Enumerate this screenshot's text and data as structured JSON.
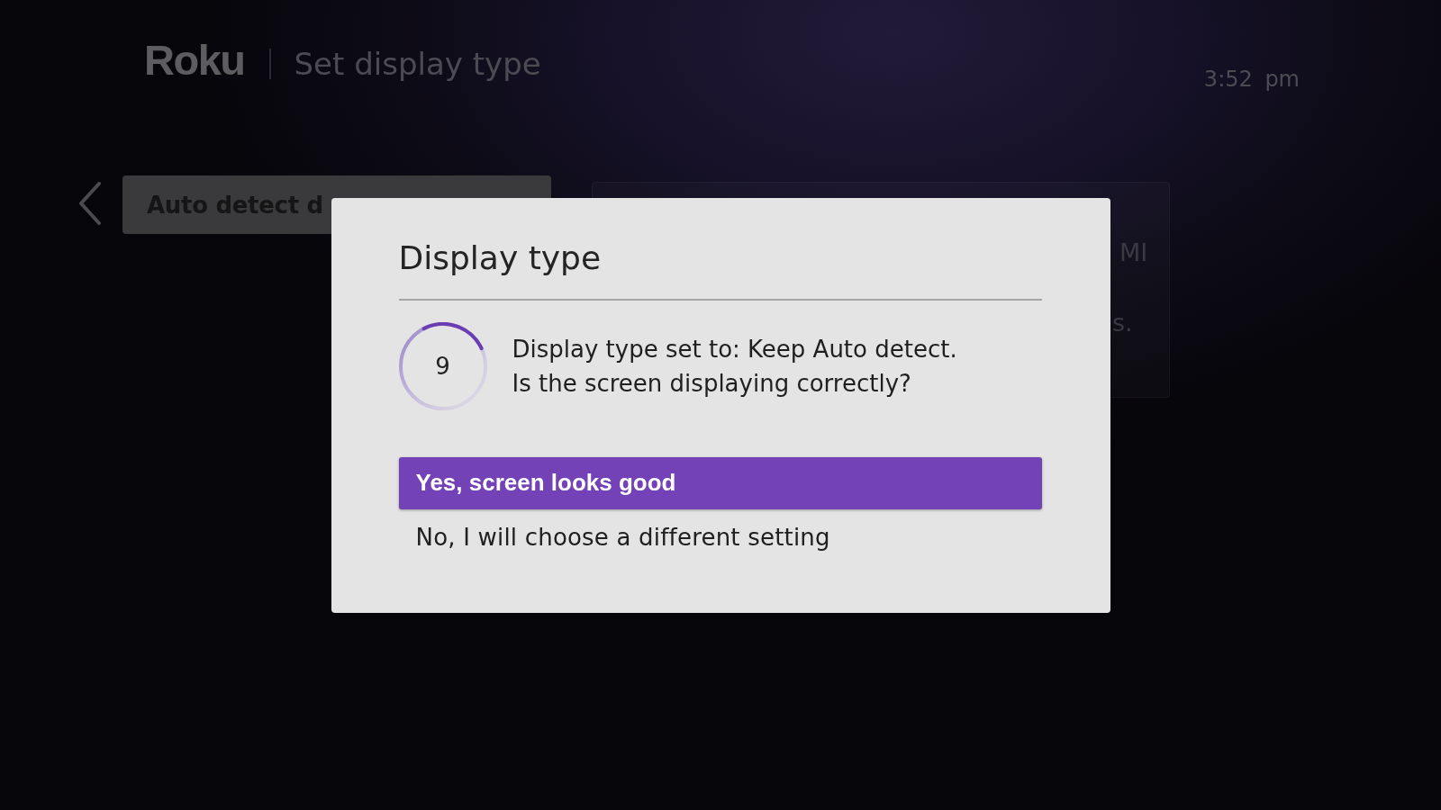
{
  "header": {
    "logo": "Roku",
    "title": "Set display type",
    "time": "3:52 pm"
  },
  "menu": {
    "items": [
      {
        "label": "Auto detect d",
        "selected": true
      }
    ]
  },
  "info_panel": {
    "lines": [
      "MI",
      "s."
    ]
  },
  "dialog": {
    "title": "Display type",
    "countdown": "9",
    "message": [
      "Display type set to: Keep Auto detect.",
      "Is the screen displaying correctly?"
    ],
    "options": [
      {
        "label": "Yes, screen looks good",
        "selected": true
      },
      {
        "label": "No, I will choose a different setting",
        "selected": false
      }
    ]
  }
}
